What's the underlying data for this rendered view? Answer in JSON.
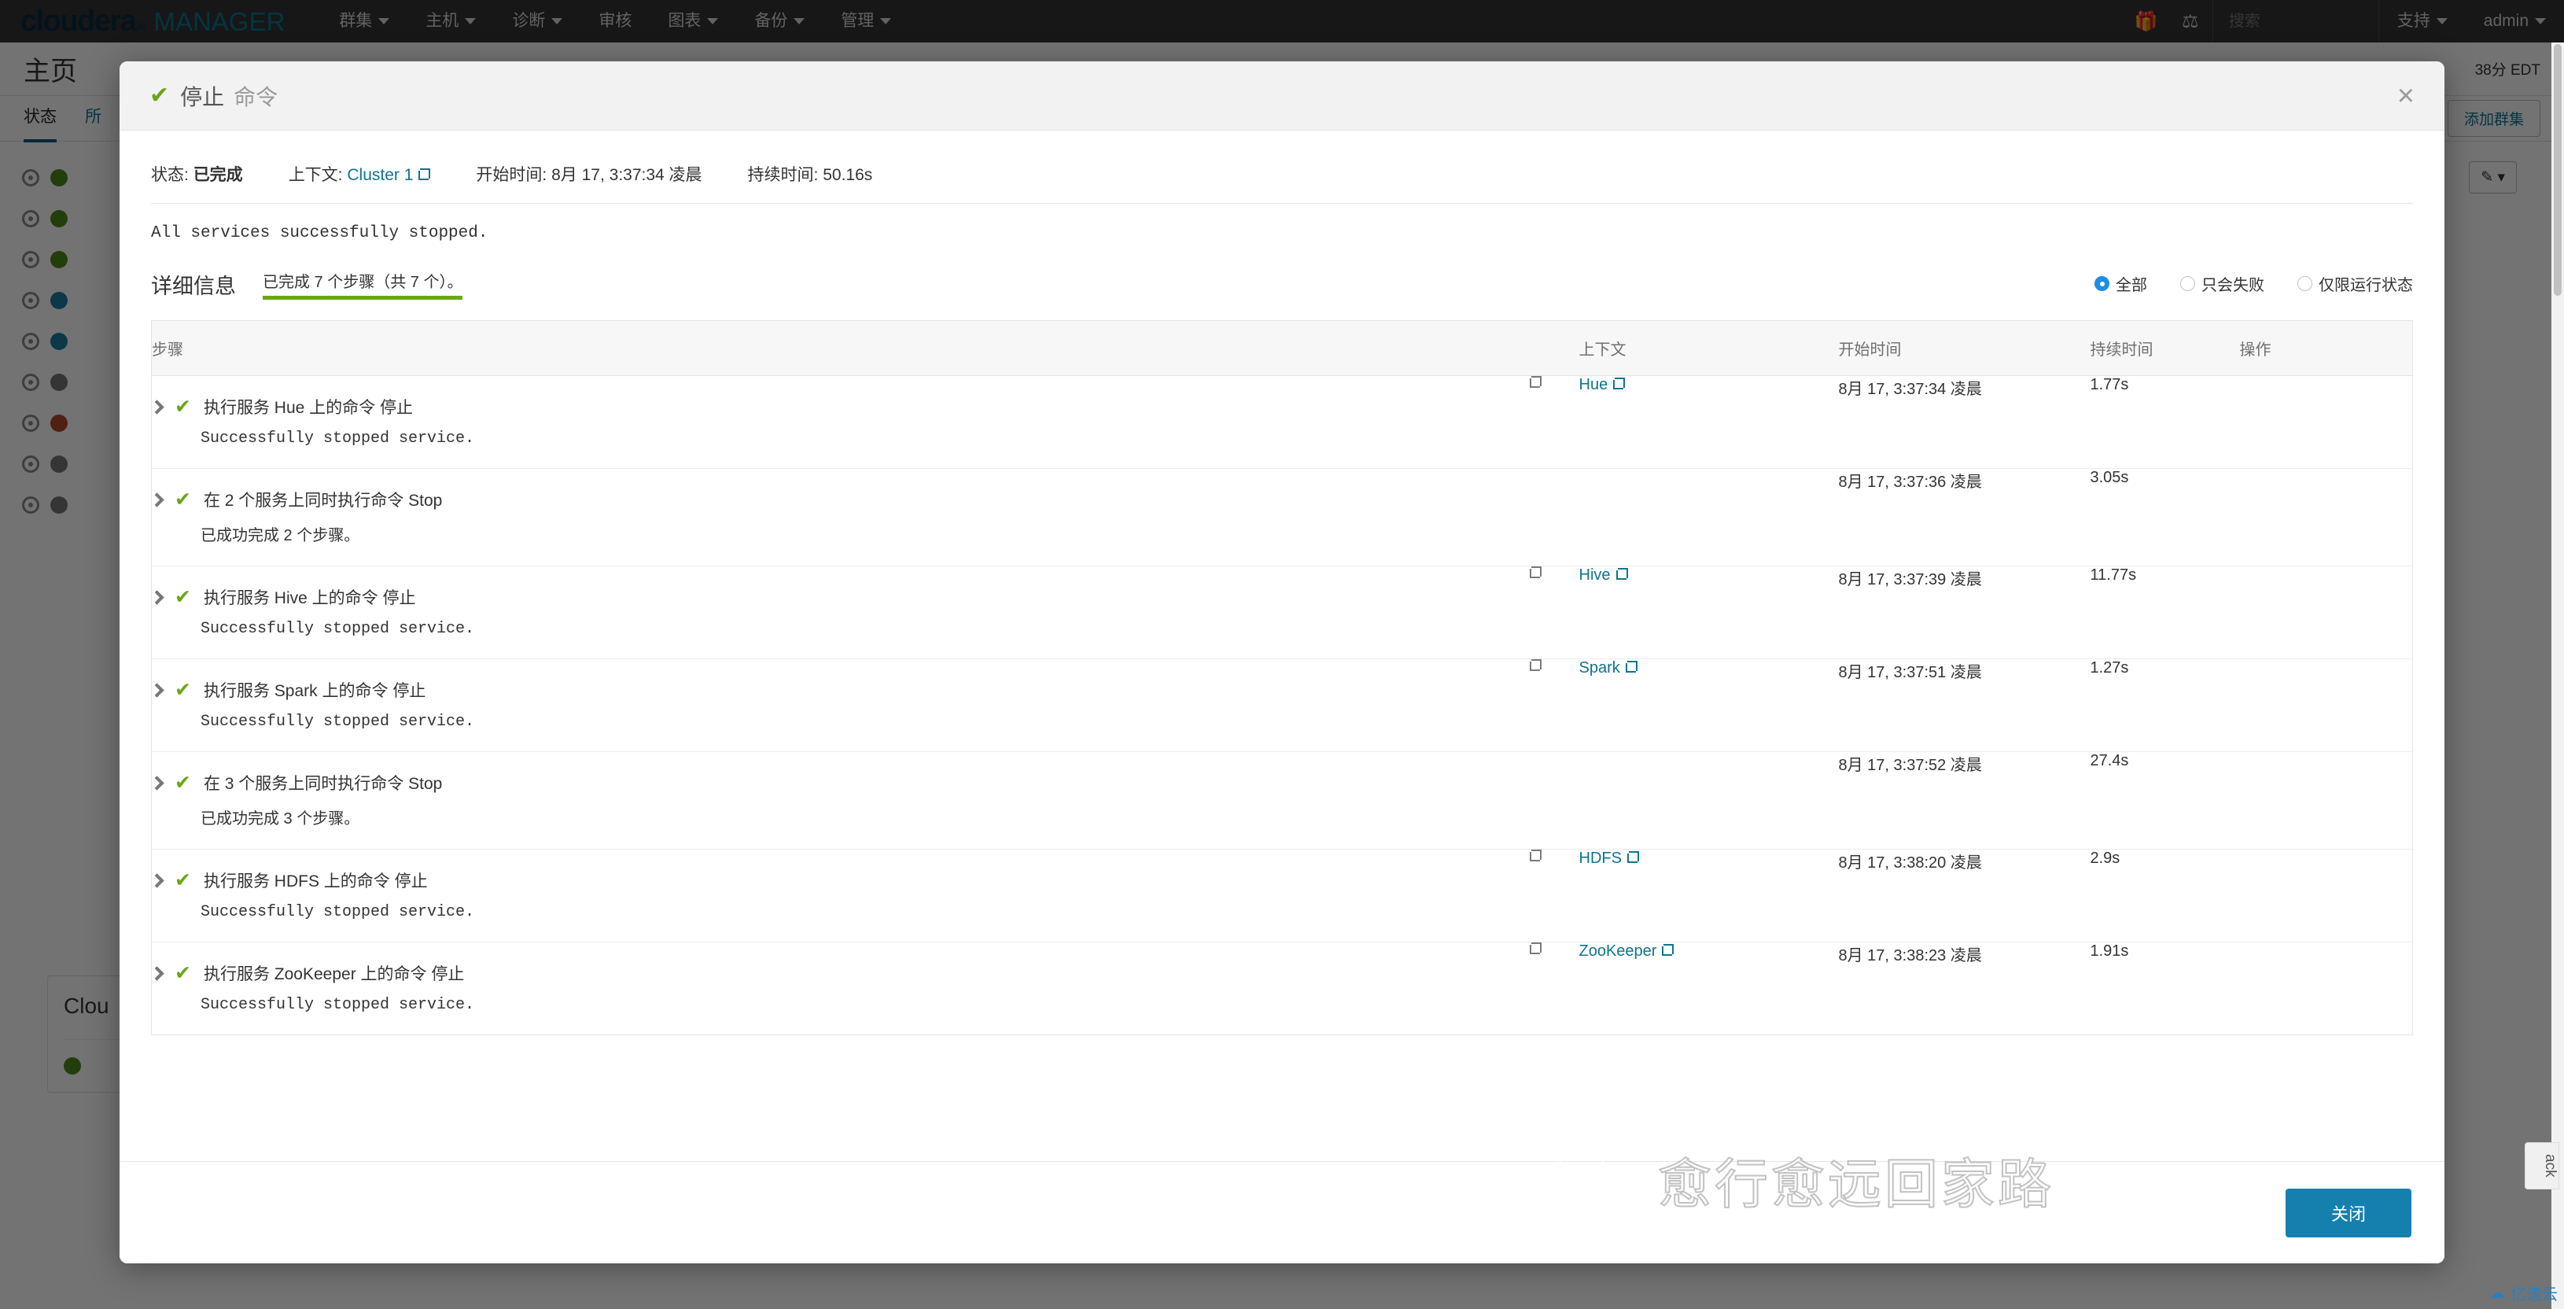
{
  "navbar": {
    "brand_main": "cloudera",
    "brand_reg": "®",
    "brand_sub": "MANAGER",
    "menu": [
      {
        "label": "群集",
        "caret": true
      },
      {
        "label": "主机",
        "caret": true
      },
      {
        "label": "诊断",
        "caret": true
      },
      {
        "label": "审核",
        "caret": false
      },
      {
        "label": "图表",
        "caret": true
      },
      {
        "label": "备份",
        "caret": true
      },
      {
        "label": "管理",
        "caret": true
      }
    ],
    "gift_icon": "gift-icon",
    "parcel_icon": "parcel-icon",
    "search_placeholder": "搜索",
    "search_value": "",
    "support": "支持",
    "user": "admin"
  },
  "background": {
    "page_title": "主页",
    "clock": "38分 EDT",
    "tabs": [
      {
        "label": "状态",
        "active": true
      },
      {
        "label": "所",
        "active": false
      }
    ],
    "add_cluster_button": "添加群集",
    "cluster_card_title": "Clou",
    "edit_button": "edit"
  },
  "modal": {
    "title": "停止",
    "title_sub": "命令",
    "header_check": "✔",
    "close_icon": "×",
    "status": {
      "status_label": "状态:",
      "status_value": "已完成",
      "context_label": "上下文:",
      "context_value": "Cluster 1",
      "start_label": "开始时间:",
      "start_value": "8月 17, 3:37:34 凌晨",
      "duration_label": "持续时间:",
      "duration_value": "50.16s"
    },
    "message": "All services successfully stopped.",
    "detail_title": "详细信息",
    "progress_text": "已完成 7 个步骤（共 7 个）。",
    "progress_percent": 100,
    "filters": [
      {
        "label": "全部",
        "selected": true
      },
      {
        "label": "只会失败",
        "selected": false
      },
      {
        "label": "仅限运行状态",
        "selected": false
      }
    ],
    "table": {
      "headers": [
        "步骤",
        "",
        "上下文",
        "开始时间",
        "持续时间",
        "操作"
      ],
      "rows": [
        {
          "step": "执行服务 Hue 上的命令 停止",
          "detail": "Successfully stopped service.",
          "detail_mono": true,
          "has_ext": true,
          "context": "Hue",
          "start": "8月 17, 3:37:34 凌晨",
          "duration": "1.77s",
          "action": ""
        },
        {
          "step": "在 2 个服务上同时执行命令 Stop",
          "detail": "已成功完成 2 个步骤。",
          "detail_mono": false,
          "has_ext": false,
          "context": "",
          "start": "8月 17, 3:37:36 凌晨",
          "duration": "3.05s",
          "action": ""
        },
        {
          "step": "执行服务 Hive 上的命令 停止",
          "detail": "Successfully stopped service.",
          "detail_mono": true,
          "has_ext": true,
          "context": "Hive",
          "start": "8月 17, 3:37:39 凌晨",
          "duration": "11.77s",
          "action": ""
        },
        {
          "step": "执行服务 Spark 上的命令 停止",
          "detail": "Successfully stopped service.",
          "detail_mono": true,
          "has_ext": true,
          "context": "Spark",
          "start": "8月 17, 3:37:51 凌晨",
          "duration": "1.27s",
          "action": ""
        },
        {
          "step": "在 3 个服务上同时执行命令 Stop",
          "detail": "已成功完成 3 个步骤。",
          "detail_mono": false,
          "has_ext": false,
          "context": "",
          "start": "8月 17, 3:37:52 凌晨",
          "duration": "27.4s",
          "action": ""
        },
        {
          "step": "执行服务 HDFS 上的命令 停止",
          "detail": "Successfully stopped service.",
          "detail_mono": true,
          "has_ext": true,
          "context": "HDFS",
          "start": "8月 17, 3:38:20 凌晨",
          "duration": "2.9s",
          "action": ""
        },
        {
          "step": "执行服务 ZooKeeper 上的命令 停止",
          "detail": "Successfully stopped service.",
          "detail_mono": true,
          "has_ext": true,
          "context": "ZooKeeper",
          "start": "8月 17, 3:38:23 凌晨",
          "duration": "1.91s",
          "action": ""
        }
      ]
    },
    "close_button": "关闭"
  },
  "watermarks": {
    "wechat_text": "愈行愈远回家路",
    "corner_text": "亿速云",
    "side_tab": "ack"
  },
  "colors": {
    "navbar_bg": "#333333",
    "brand_dark": "#0b2b3c",
    "brand_teal": "#0e7490",
    "success_green": "#6aa616",
    "link_blue": "#0e7490",
    "radio_blue": "#1f8ce6",
    "primary_button": "#1580ae"
  }
}
